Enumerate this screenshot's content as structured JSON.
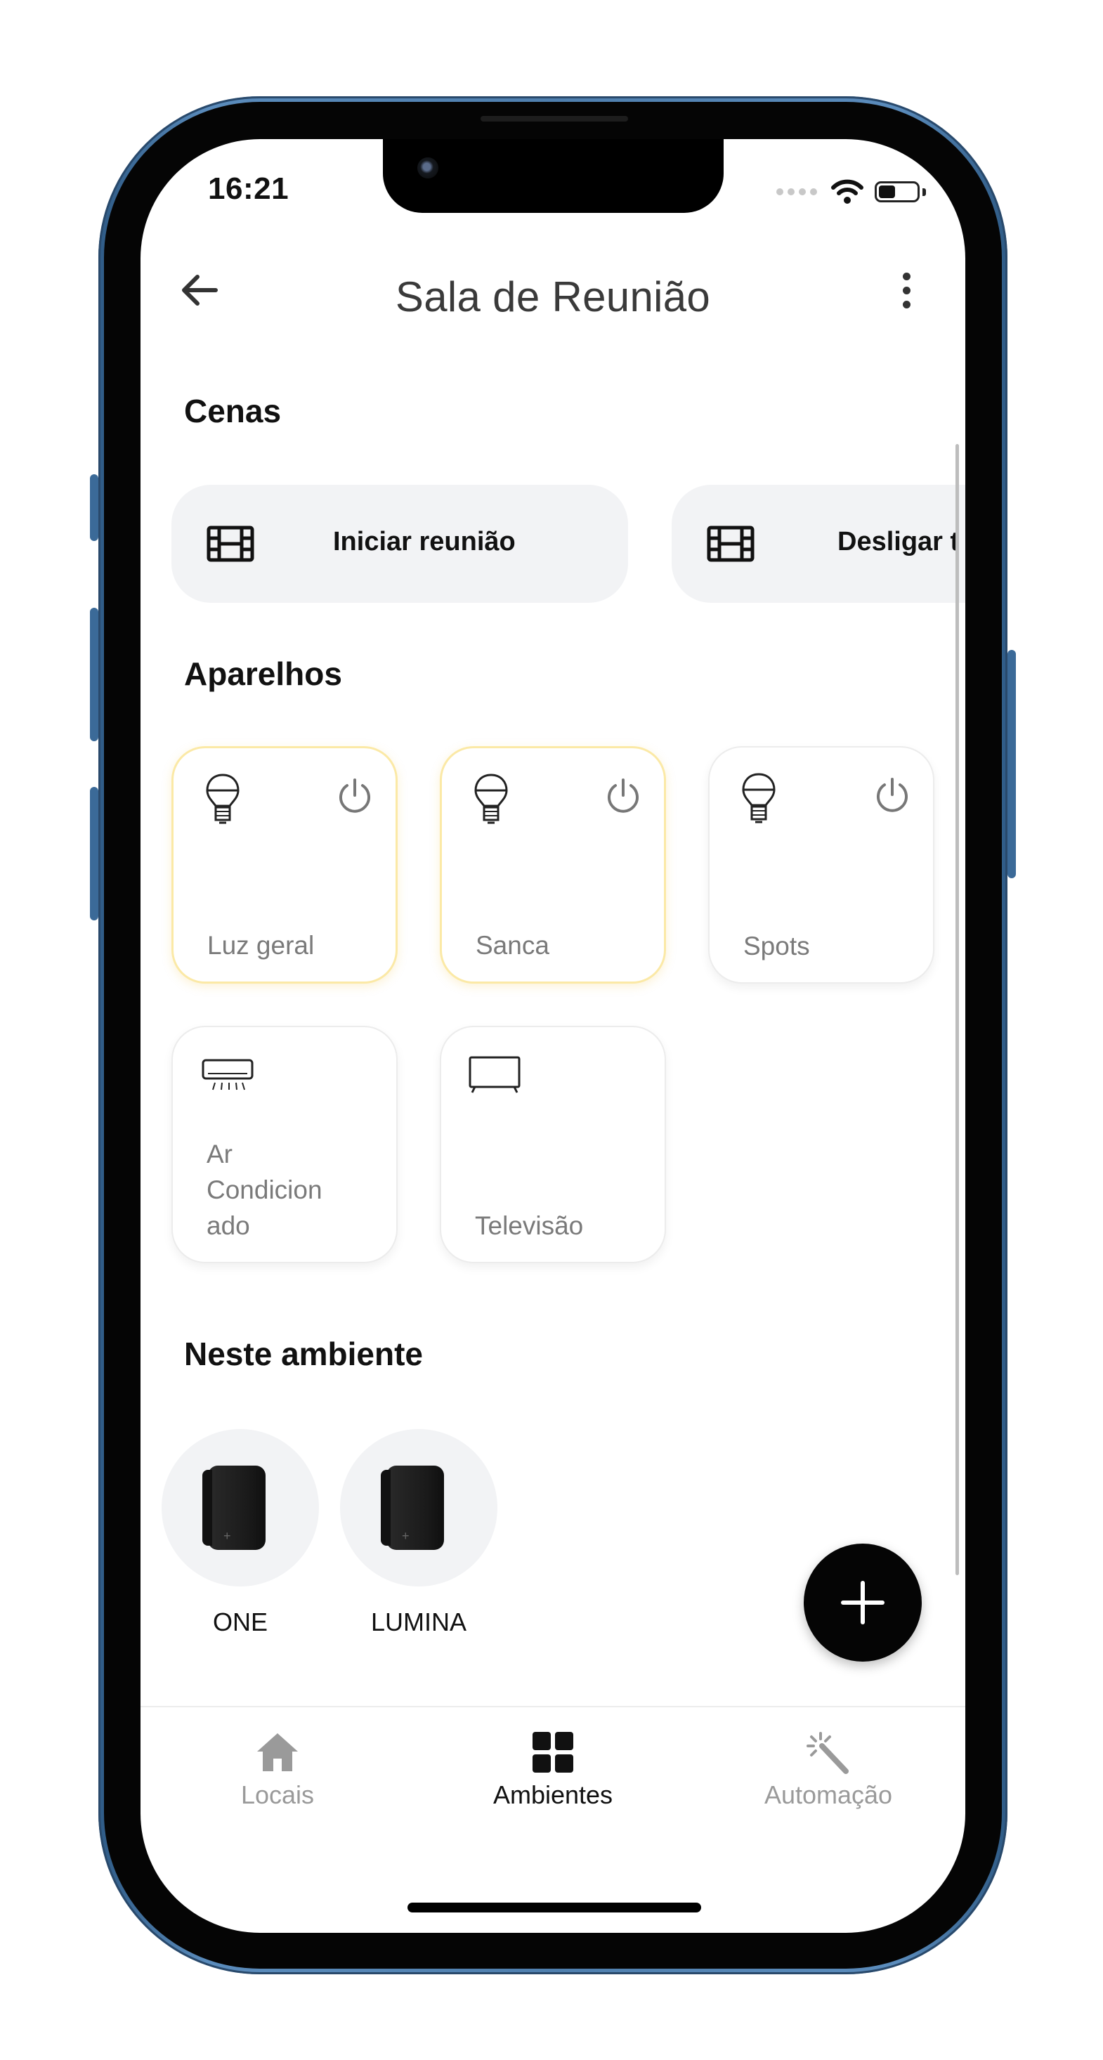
{
  "status_bar": {
    "time": "16:21",
    "battery_level": 0.45,
    "icons": [
      "signal-dots-icon",
      "wifi-icon",
      "battery-icon"
    ]
  },
  "header": {
    "title": "Sala de Reunião",
    "back_icon": "arrow-left-icon",
    "menu_icon": "more-vertical-icon"
  },
  "scenes": {
    "title": "Cenas",
    "items": [
      {
        "label": "Iniciar reunião",
        "icon": "film-icon"
      },
      {
        "label": "Desligar t",
        "icon": "film-icon"
      }
    ]
  },
  "devices": {
    "title": "Aparelhos",
    "items": [
      {
        "label": "Luz geral",
        "icon": "light-bulb-icon",
        "on": true
      },
      {
        "label": "Sanca",
        "icon": "light-bulb-icon",
        "on": true
      },
      {
        "label": "Spots",
        "icon": "light-bulb-icon",
        "on": false
      },
      {
        "label": "Ar\nCondicion\nado",
        "icon": "air-conditioner-icon"
      },
      {
        "label": "Televisão",
        "icon": "tv-icon"
      }
    ]
  },
  "rooms": {
    "title": "Neste ambiente",
    "items": [
      {
        "label": "ONE",
        "icon": "device-box-icon"
      },
      {
        "label": "LUMINA",
        "icon": "device-box-icon"
      }
    ]
  },
  "fab": {
    "icon": "plus-icon"
  },
  "nav": {
    "items": [
      {
        "label": "Locais",
        "icon": "home-icon",
        "active": false
      },
      {
        "label": "Ambientes",
        "icon": "grid-icon",
        "active": true
      },
      {
        "label": "Automação",
        "icon": "magic-wand-icon",
        "active": false
      }
    ]
  },
  "colors": {
    "accent": "#050505",
    "card_background": "#f2f3f5",
    "active_border": "#fbe9a6",
    "inactive_nav": "#9a9a9a",
    "frame_blue": "#4f7fae"
  }
}
